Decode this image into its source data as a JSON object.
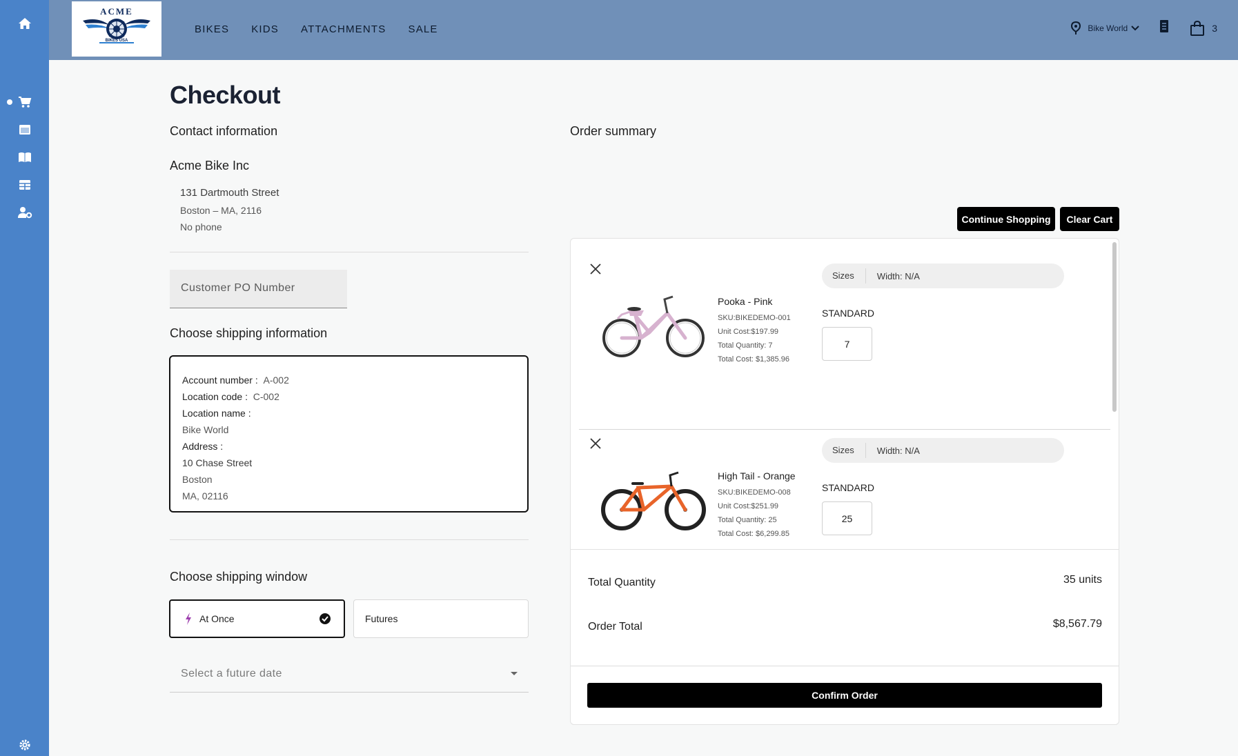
{
  "brand": {
    "logo_top_text": "ACME",
    "logo_bottom_text": "BIKES USA"
  },
  "nav": [
    "BIKES",
    "KIDS",
    "ATTACHMENTS",
    "SALE"
  ],
  "header": {
    "location": "Bike World",
    "cart_count": "3"
  },
  "sidebar": {
    "icons": [
      "home-icon",
      "cart-icon",
      "browser-icon",
      "catalog-icon",
      "table-icon",
      "user-settings-icon",
      "settings-icon"
    ]
  },
  "page": {
    "title": "Checkout"
  },
  "contact": {
    "heading": "Contact information",
    "company": "Acme Bike Inc",
    "street": "131 Dartmouth Street",
    "city_line": "Boston – MA, 2116",
    "phone": "No phone"
  },
  "po": {
    "placeholder": "Customer PO Number"
  },
  "shipping": {
    "heading": "Choose shipping information",
    "account_label": "Account number :",
    "account_value": "A-002",
    "location_code_label": "Location code :",
    "location_code_value": "C-002",
    "location_name_label": "Location name :",
    "location_name_value": "Bike World",
    "address_label": "Address :",
    "address_line1": "10 Chase Street",
    "address_line2": "Boston",
    "address_line3": "MA, 02116"
  },
  "window": {
    "heading": "Choose shipping window",
    "at_once": "At Once",
    "futures": "Futures",
    "date_placeholder": "Select a future date"
  },
  "summary": {
    "heading": "Order summary",
    "continue_label": "Continue Shopping",
    "clear_label": "Clear Cart",
    "items": [
      {
        "name": "Pooka - Pink",
        "sku": "SKU:BIKEDEMO-001",
        "unit_cost": "Unit Cost:$197.99",
        "total_qty": "Total Quantity: 7",
        "total_cost": "Total Cost: $1,385.96",
        "sizes_label": "Sizes",
        "width": "Width: N/A",
        "size_name": "STANDARD",
        "qty": "7",
        "color": "#d7b2cf"
      },
      {
        "name": "High Tail - Orange",
        "sku": "SKU:BIKEDEMO-008",
        "unit_cost": "Unit Cost:$251.99",
        "total_qty": "Total Quantity: 25",
        "total_cost": "Total Cost: $6,299.85",
        "sizes_label": "Sizes",
        "width": "Width: N/A",
        "size_name": "STANDARD",
        "qty": "25",
        "color": "#e8642a"
      }
    ],
    "total_qty_label": "Total Quantity",
    "total_qty_value": "35 units",
    "order_total_label": "Order Total",
    "order_total_value": "$8,567.79",
    "confirm_label": "Confirm Order"
  }
}
